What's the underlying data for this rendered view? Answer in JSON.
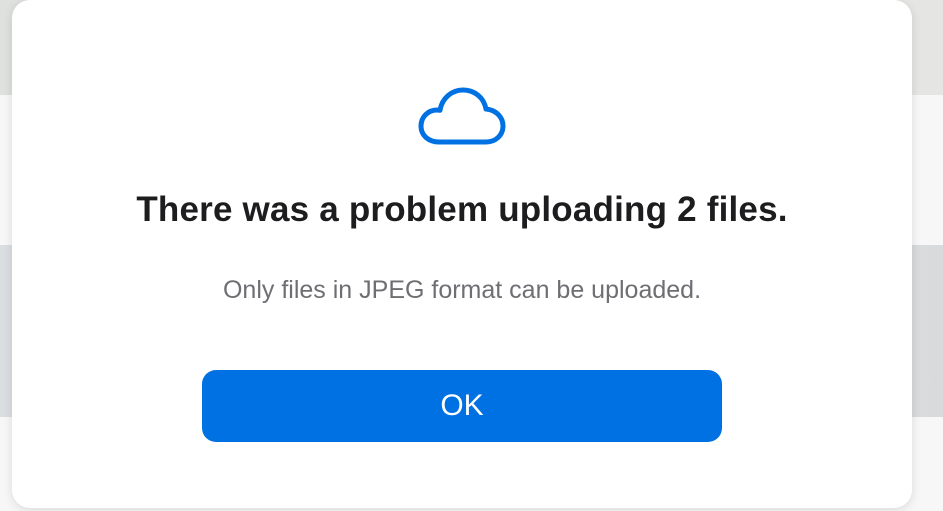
{
  "dialog": {
    "icon": "cloud-icon",
    "title": "There was a problem uploading 2 files.",
    "message": "Only files in JPEG format can be uploaded.",
    "ok_label": "OK"
  },
  "colors": {
    "accent": "#0071e3",
    "title_text": "#1d1d1f",
    "message_text": "#6e6e73",
    "dialog_background": "#ffffff"
  }
}
